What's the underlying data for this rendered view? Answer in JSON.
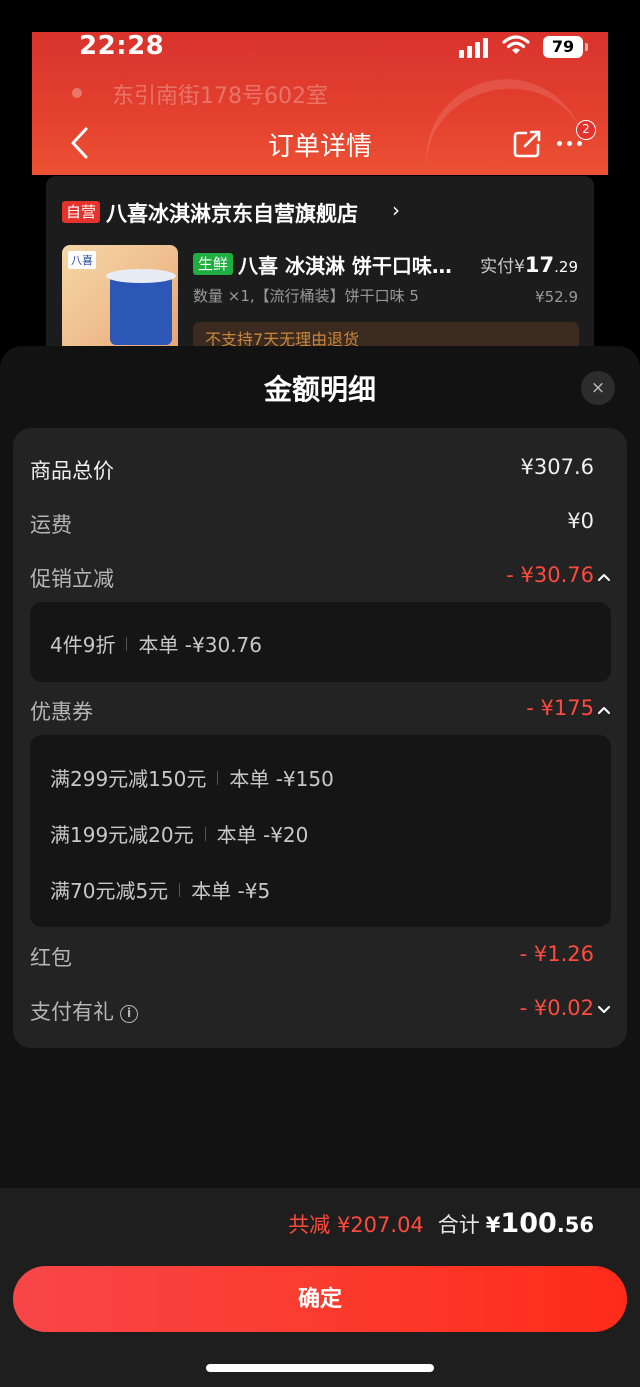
{
  "status_bar": {
    "time": "22:28",
    "battery": "79"
  },
  "background": {
    "address_text": "东引南街178号602室",
    "nav_title": "订单详情",
    "badge_count": "2",
    "shop": {
      "tag": "自营",
      "name": "八喜冰淇淋京东自营旗舰店",
      "arrow": "›"
    },
    "product": {
      "tag": "生鲜",
      "name": "八喜 冰淇淋 饼干口味…",
      "paid_prefix": "实付¥",
      "paid_int": "17",
      "paid_dec": ".29",
      "spec": "数量 ×1,【流行桶装】饼干口味 5",
      "original_price": "¥52.9",
      "return_notice": "不支持7天无理由退货",
      "thumb_label": "八喜"
    }
  },
  "sheet": {
    "title": "金额明细",
    "close_icon": "×",
    "rows": {
      "goods_total": {
        "label": "商品总价",
        "value": "¥307.6"
      },
      "shipping": {
        "label": "运费",
        "value": "¥0"
      },
      "promo": {
        "label": "促销立减",
        "value": "- ¥30.76"
      },
      "coupon": {
        "label": "优惠券",
        "value": "- ¥175"
      },
      "red_packet": {
        "label": "红包",
        "value": "- ¥1.26"
      },
      "pay_gift": {
        "label": "支付有礼",
        "value": "- ¥0.02",
        "info_icon": "i"
      }
    },
    "promo_details": [
      {
        "name": "4件9折",
        "amount": "本单 -¥30.76"
      }
    ],
    "coupon_details": [
      {
        "name": "满299元减150元",
        "amount": "本单 -¥150"
      },
      {
        "name": "满199元减20元",
        "amount": "本单 -¥20"
      },
      {
        "name": "满70元减5元",
        "amount": "本单 -¥5"
      }
    ]
  },
  "footer": {
    "saved": "共减 ¥207.04",
    "total_label": "合计",
    "total_currency": "¥",
    "total_int": "100",
    "total_dec": ".56",
    "confirm_label": "确定"
  },
  "colors": {
    "accent_red": "#ff4a3c",
    "header_red": "#e4412f",
    "fresh_green": "#1fae3f"
  }
}
